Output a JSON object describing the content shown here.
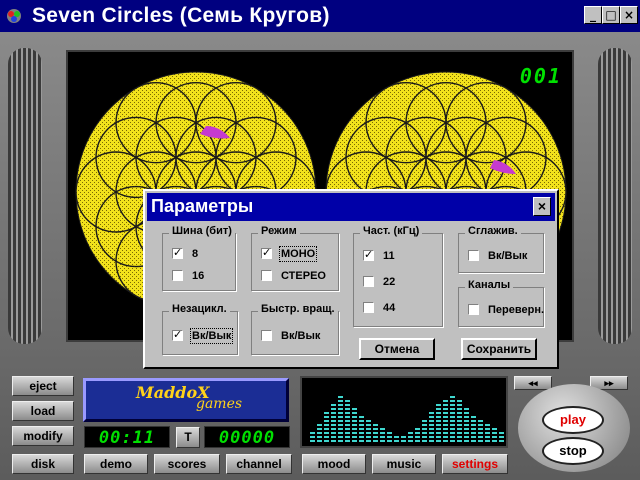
{
  "window": {
    "title": "Seven Circles (Семь Кругов)",
    "controls": {
      "minimize": "_",
      "maximize": "□",
      "close": "×"
    }
  },
  "game": {
    "move_counter": "001"
  },
  "dialog": {
    "title": "Параметры",
    "close": "×",
    "groups": {
      "bus": {
        "label": "Шина (бит)",
        "options": [
          {
            "label": "8",
            "checked": true
          },
          {
            "label": "16",
            "checked": false
          }
        ]
      },
      "mode": {
        "label": "Режим",
        "options": [
          {
            "label": "МОНО",
            "checked": true
          },
          {
            "label": "СТЕРЕО",
            "checked": false
          }
        ]
      },
      "freq": {
        "label": "Част. (кГц)",
        "options": [
          {
            "label": "11",
            "checked": true
          },
          {
            "label": "22",
            "checked": false
          },
          {
            "label": "44",
            "checked": false
          }
        ]
      },
      "smooth": {
        "label": "Сглажив.",
        "options": [
          {
            "label": "Вк/Вык",
            "checked": false
          }
        ]
      },
      "channels": {
        "label": "Каналы",
        "options": [
          {
            "label": "Переверн.",
            "checked": false
          }
        ]
      },
      "nonloop": {
        "label": "Незацикл.",
        "options": [
          {
            "label": "Вк/Вык",
            "checked": true
          }
        ]
      },
      "fastrot": {
        "label": "Быстр. вращ.",
        "options": [
          {
            "label": "Вк/Вык",
            "checked": false
          }
        ]
      }
    },
    "cancel_label": "Отмена",
    "save_label": "Сохранить"
  },
  "panel": {
    "left_buttons": [
      "eject",
      "load",
      "modify",
      "disk"
    ],
    "bottom_buttons": [
      "demo",
      "scores",
      "channel"
    ],
    "right_buttons": [
      "mood",
      "music",
      "settings"
    ],
    "time": "00:11",
    "t_button": "T",
    "score": "00000",
    "logo_line1": "MaddoX",
    "logo_line2": "games",
    "play_label": "play",
    "stop_label": "stop",
    "rewind": "◂◂",
    "forward": "▸▸"
  },
  "colors": {
    "title_bar": "#000080",
    "dialog_title": "#0000a8",
    "petal_yellow": "#f2e21c",
    "petal_highlight": "#c63ad0",
    "lcd_green": "#00e000",
    "play_red": "#e00000",
    "settings_red": "#e00000"
  }
}
